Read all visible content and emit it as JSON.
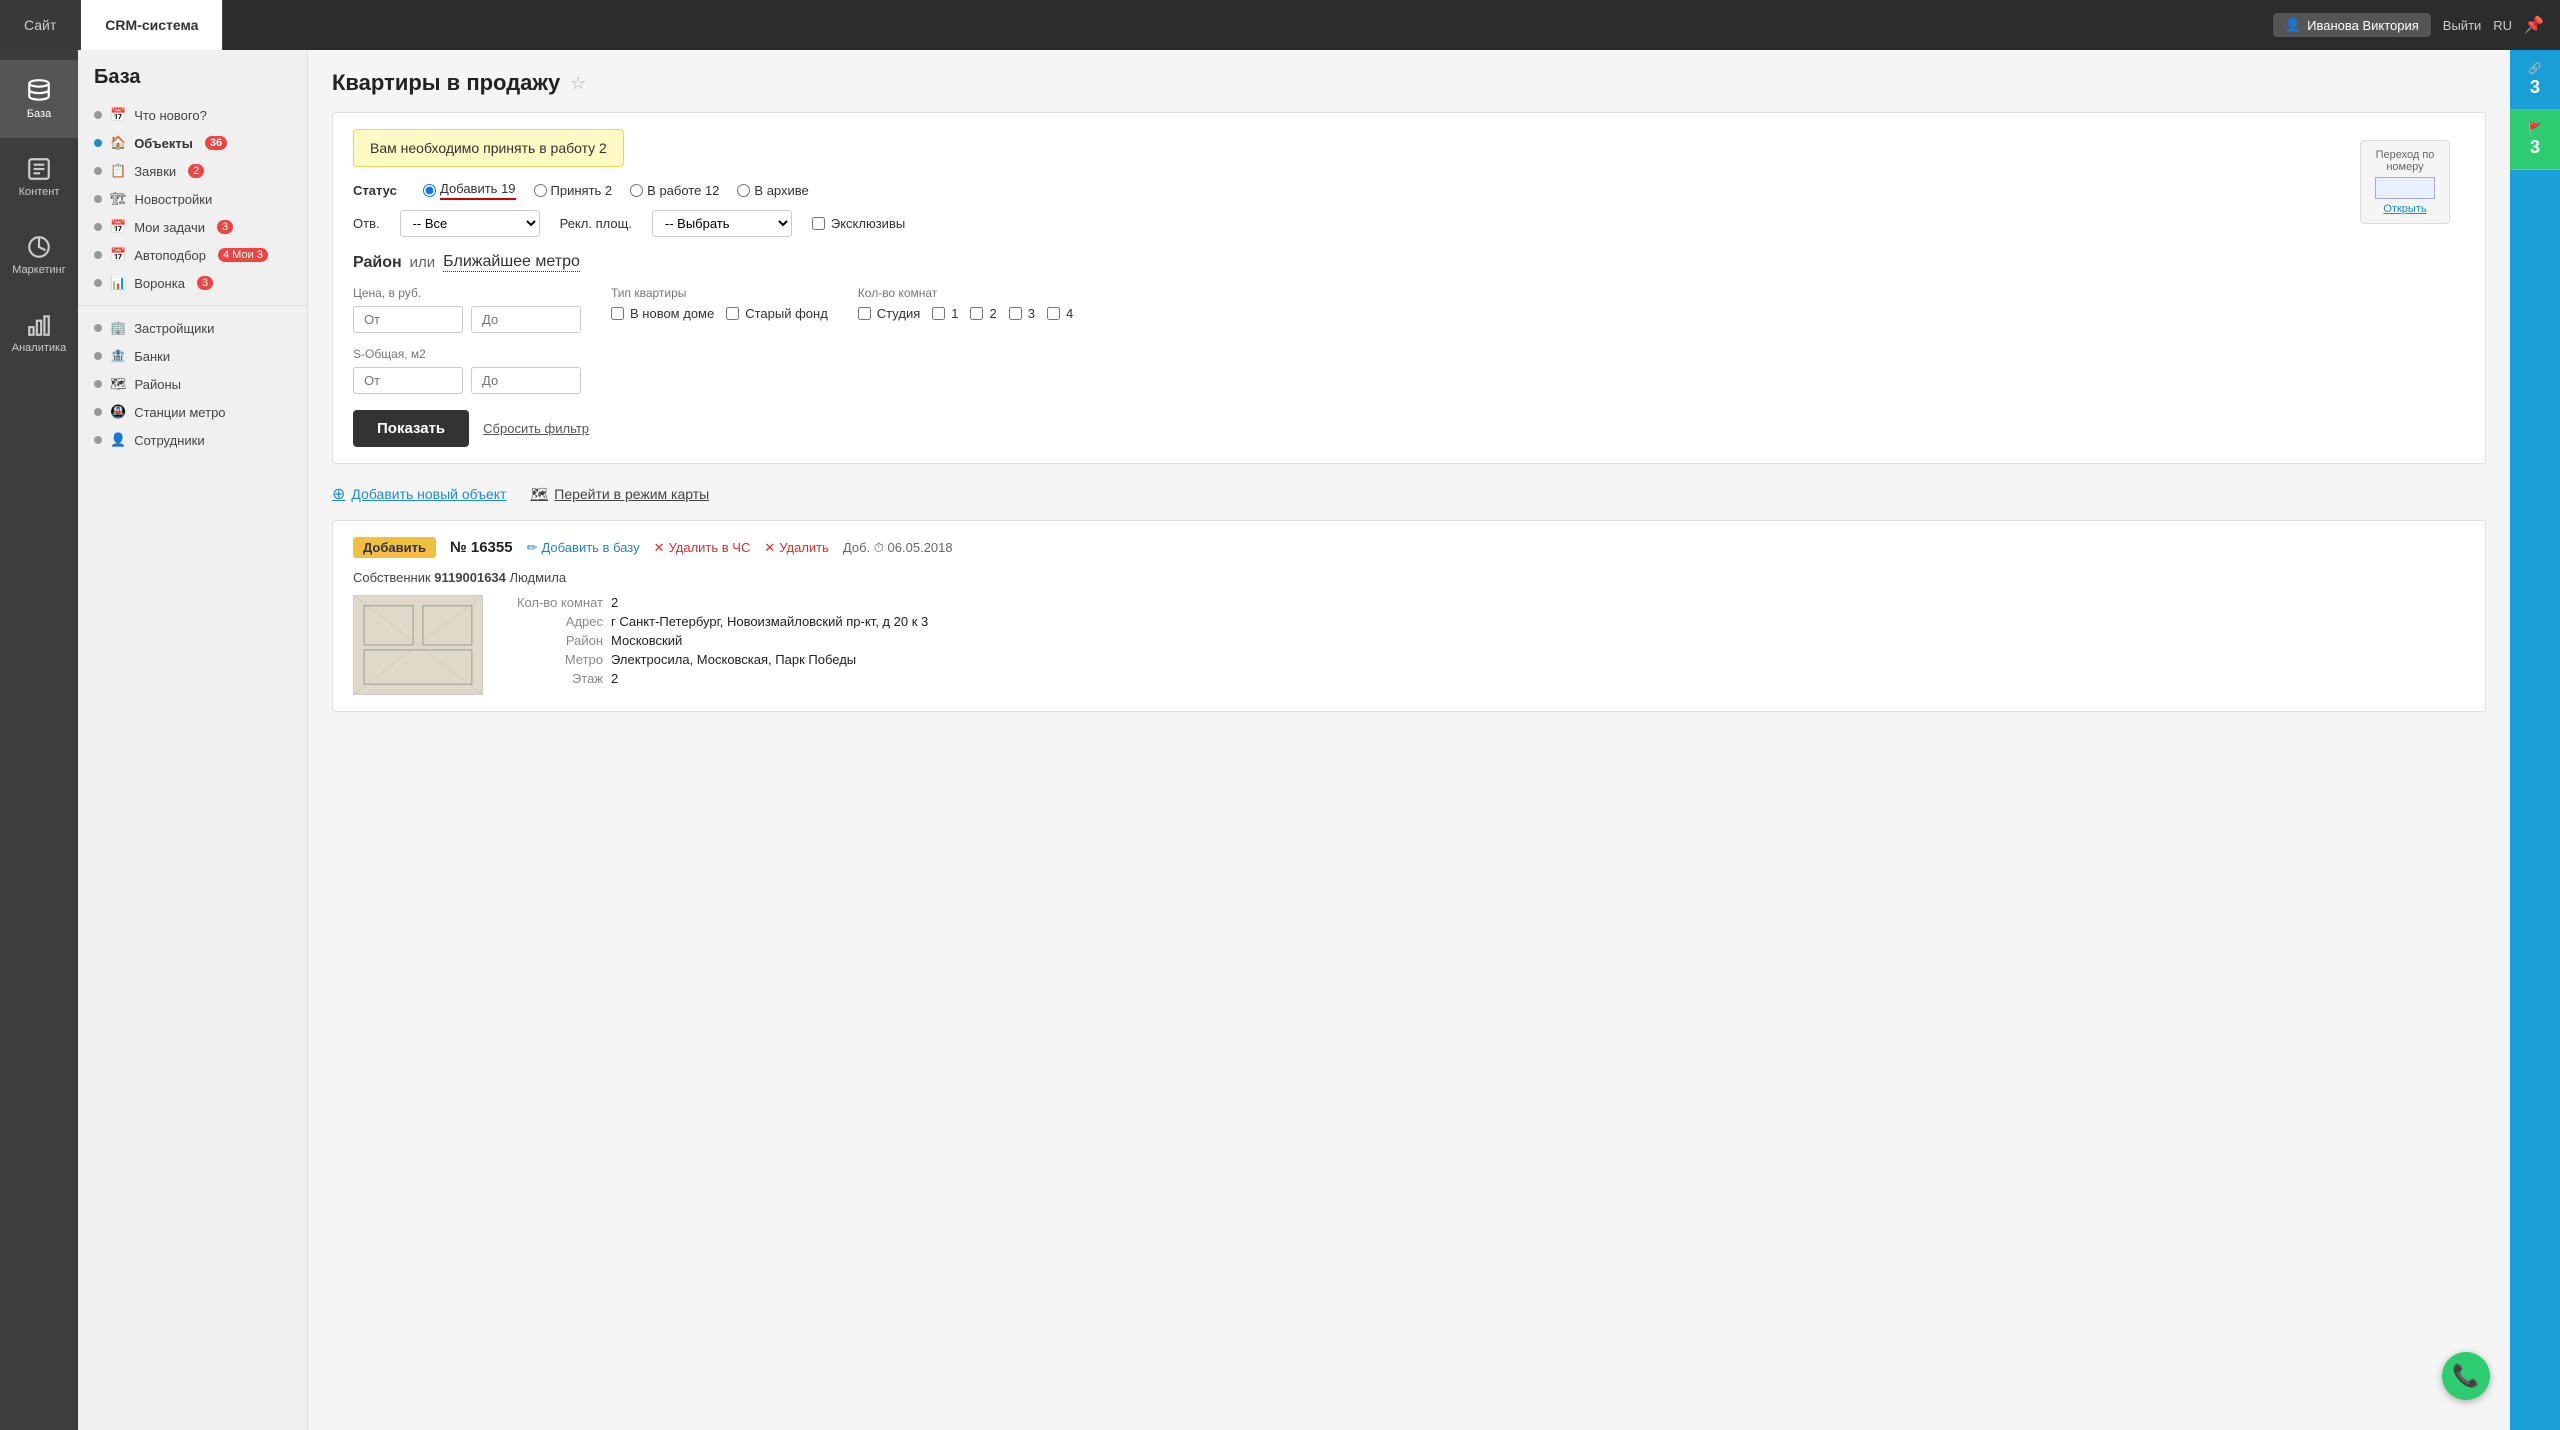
{
  "topNav": {
    "tab1": "Сайт",
    "tab2": "CRM-система",
    "user": "Иванова Виктория",
    "logout": "Выйти",
    "lang": "RU"
  },
  "sidebar": {
    "items": [
      {
        "id": "baza",
        "label": "База",
        "active": true
      },
      {
        "id": "kontent",
        "label": "Контент",
        "active": false
      },
      {
        "id": "marketing",
        "label": "Маркетинг",
        "active": false
      },
      {
        "id": "analitika",
        "label": "Аналитика",
        "active": false
      }
    ]
  },
  "leftNav": {
    "title": "База",
    "items": [
      {
        "id": "chtonovogo",
        "label": "Что нового?",
        "badge": ""
      },
      {
        "id": "obekty",
        "label": "Объекты",
        "badge": "36",
        "active": true
      },
      {
        "id": "zayavki",
        "label": "Заявки",
        "badge": "2"
      },
      {
        "id": "novostroyki",
        "label": "Новостройки",
        "badge": ""
      },
      {
        "id": "moizadachi",
        "label": "Мои задачи",
        "badge": "3"
      },
      {
        "id": "avtopodpor",
        "label": "Автоподбор",
        "badge2": "4 Мои 3"
      },
      {
        "id": "voronka",
        "label": "Воронка",
        "badge": "3"
      },
      {
        "id": "zastroyshiki",
        "label": "Застройщики",
        "badge": ""
      },
      {
        "id": "banki",
        "label": "Банки",
        "badge": ""
      },
      {
        "id": "rayony",
        "label": "Районы",
        "badge": ""
      },
      {
        "id": "stancii",
        "label": "Станции метро",
        "badge": ""
      },
      {
        "id": "sotrudniki",
        "label": "Сотрудники",
        "badge": ""
      }
    ]
  },
  "page": {
    "title": "Квартиры в продажу",
    "alertBanner": "Вам необходимо принять в работу 2",
    "statusLabel": "Статус",
    "statuses": [
      {
        "label": "Добавить 19",
        "active": true
      },
      {
        "label": "Принять 2",
        "active": false
      },
      {
        "label": "В работе 12",
        "active": false
      },
      {
        "label": "В архиве",
        "active": false
      }
    ],
    "otvetLabel": "Отв.",
    "otvetSelect": "-- Все",
    "reklLabel": "Рекл. площ.",
    "reklSelect": "-- Выбрать",
    "exclusiveLabel": "Эксклюзивы",
    "districtTab": "Район",
    "orLabel": "или",
    "metroTab": "Ближайшее метро",
    "priceLabel": "Цена, в руб.",
    "priceFrom": "От",
    "priceTo": "До",
    "aptTypeLabel": "Тип квартиры",
    "aptTypes": [
      {
        "label": "В новом доме"
      },
      {
        "label": "Старый фонд"
      }
    ],
    "roomCountLabel": "Кол-во комнат",
    "roomCounts": [
      {
        "label": "Студия"
      },
      {
        "label": "1"
      },
      {
        "label": "2"
      },
      {
        "label": "3"
      },
      {
        "label": "4"
      }
    ],
    "areaLabel": "S-Общая, м2",
    "areaFrom": "От",
    "areaTo": "До",
    "showBtn": "Показать",
    "resetLink": "Сбросить фильтр",
    "addNewLink": "Добавить новый объект",
    "mapLink": "Перейти в режим карты",
    "navWidget": {
      "label1": "Переход",
      "label2": "по",
      "label3": "номеру",
      "openLink": "Открыть"
    }
  },
  "listing": {
    "badge": "Добавить",
    "number": "№ 16355",
    "addToBase": "Добавить в базу",
    "deleteFromBl": "Удалить в ЧС",
    "delete": "Удалить",
    "addedLabel": "Доб.",
    "addedDate": "06.05.2018",
    "ownerLabel": "Собственник",
    "ownerPhone": "9119001634",
    "ownerName": "Людмила",
    "details": [
      {
        "label": "Кол-во комнат",
        "value": "2"
      },
      {
        "label": "Адрес",
        "value": "г Санкт-Петербург, Новоизмайловский пр-кт, д 20 к 3"
      },
      {
        "label": "Район",
        "value": "Московский"
      },
      {
        "label": "Метро",
        "value": "Электросила, Московская, Парк Победы"
      },
      {
        "label": "Этаж",
        "value": "2"
      }
    ]
  },
  "rightPanel": {
    "btn1Count": "3",
    "btn2Count": "3"
  },
  "phoneFab": "📞"
}
